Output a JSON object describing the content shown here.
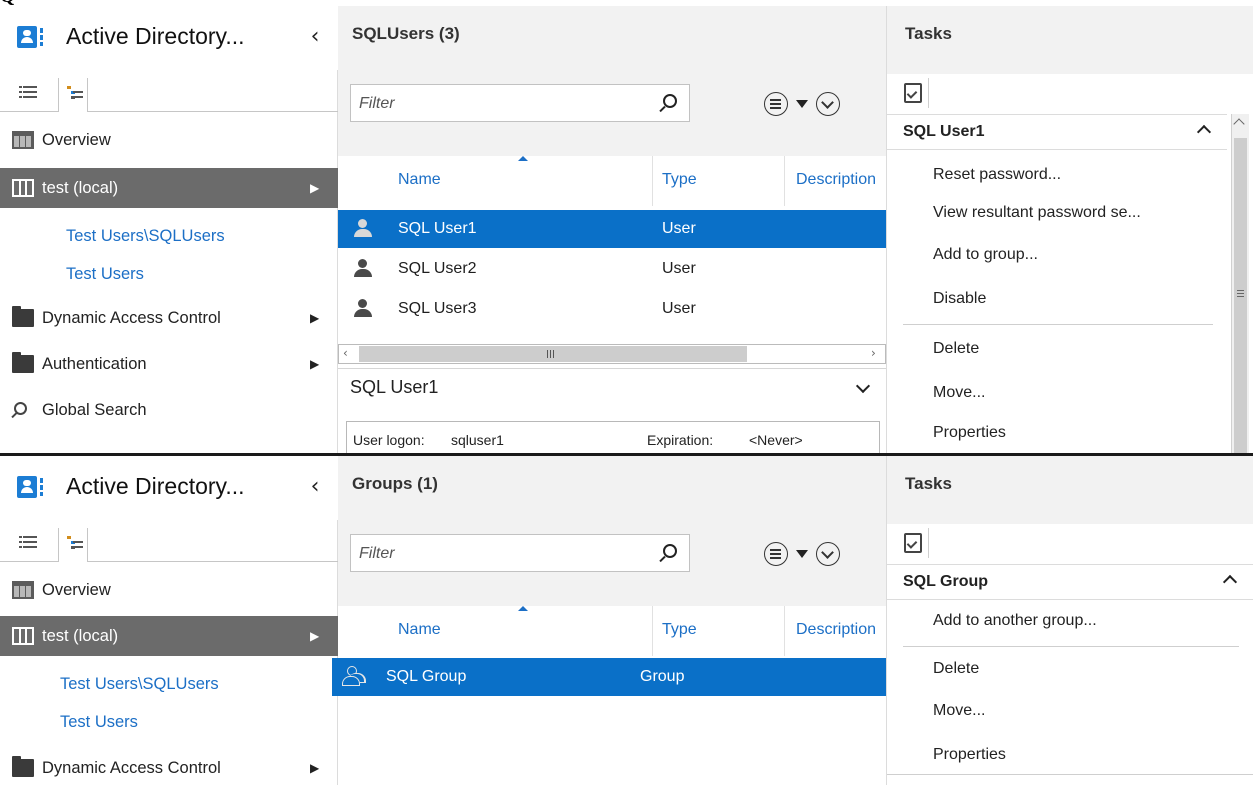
{
  "caption": "Q",
  "top_window": {
    "nav": {
      "app_title": "Active Directory...",
      "items": [
        {
          "label": "Overview",
          "icon": "overview-icon"
        },
        {
          "label": "test (local)",
          "icon": "server-icon",
          "selected": true
        },
        {
          "label": "Test Users\\SQLUsers"
        },
        {
          "label": "Test Users"
        },
        {
          "label": "Dynamic Access Control",
          "icon": "folder-icon"
        },
        {
          "label": "Authentication",
          "icon": "folder-icon"
        },
        {
          "label": "Global Search",
          "icon": "search-icon"
        }
      ]
    },
    "content": {
      "title": "SQLUsers (3)",
      "filter_placeholder": "Filter",
      "columns": [
        "Name",
        "Type",
        "Description"
      ],
      "rows": [
        {
          "name": "SQL User1",
          "type": "User",
          "selected": true
        },
        {
          "name": "SQL User2",
          "type": "User"
        },
        {
          "name": "SQL User3",
          "type": "User"
        }
      ],
      "preview": {
        "title": "SQL User1",
        "logon_label": "User logon:",
        "logon_value": "sqluser1",
        "expiration_label": "Expiration:",
        "expiration_value": "<Never>"
      }
    },
    "tasks": {
      "title": "Tasks",
      "section": "SQL User1",
      "items": [
        "Reset password...",
        "View resultant password se...",
        "Add to group...",
        "Disable",
        "Delete",
        "Move...",
        "Properties"
      ]
    }
  },
  "bottom_window": {
    "nav": {
      "app_title": "Active Directory...",
      "items": [
        {
          "label": "Overview",
          "icon": "overview-icon"
        },
        {
          "label": "test (local)",
          "icon": "server-icon",
          "selected": true
        },
        {
          "label": "Test Users\\SQLUsers"
        },
        {
          "label": "Test Users"
        },
        {
          "label": "Dynamic Access Control",
          "icon": "folder-icon"
        }
      ]
    },
    "content": {
      "title": "Groups (1)",
      "filter_placeholder": "Filter",
      "columns": [
        "Name",
        "Type",
        "Description"
      ],
      "rows": [
        {
          "name": "SQL Group",
          "type": "Group",
          "selected": true
        }
      ]
    },
    "tasks": {
      "title": "Tasks",
      "section": "SQL Group",
      "items": [
        "Add to another group...",
        "Delete",
        "Move...",
        "Properties"
      ]
    }
  },
  "colors": {
    "selection": "#0a70c8",
    "nav_selected": "#6b6b6b",
    "link": "#1c6fc6",
    "brand": "#1c7dd4"
  }
}
